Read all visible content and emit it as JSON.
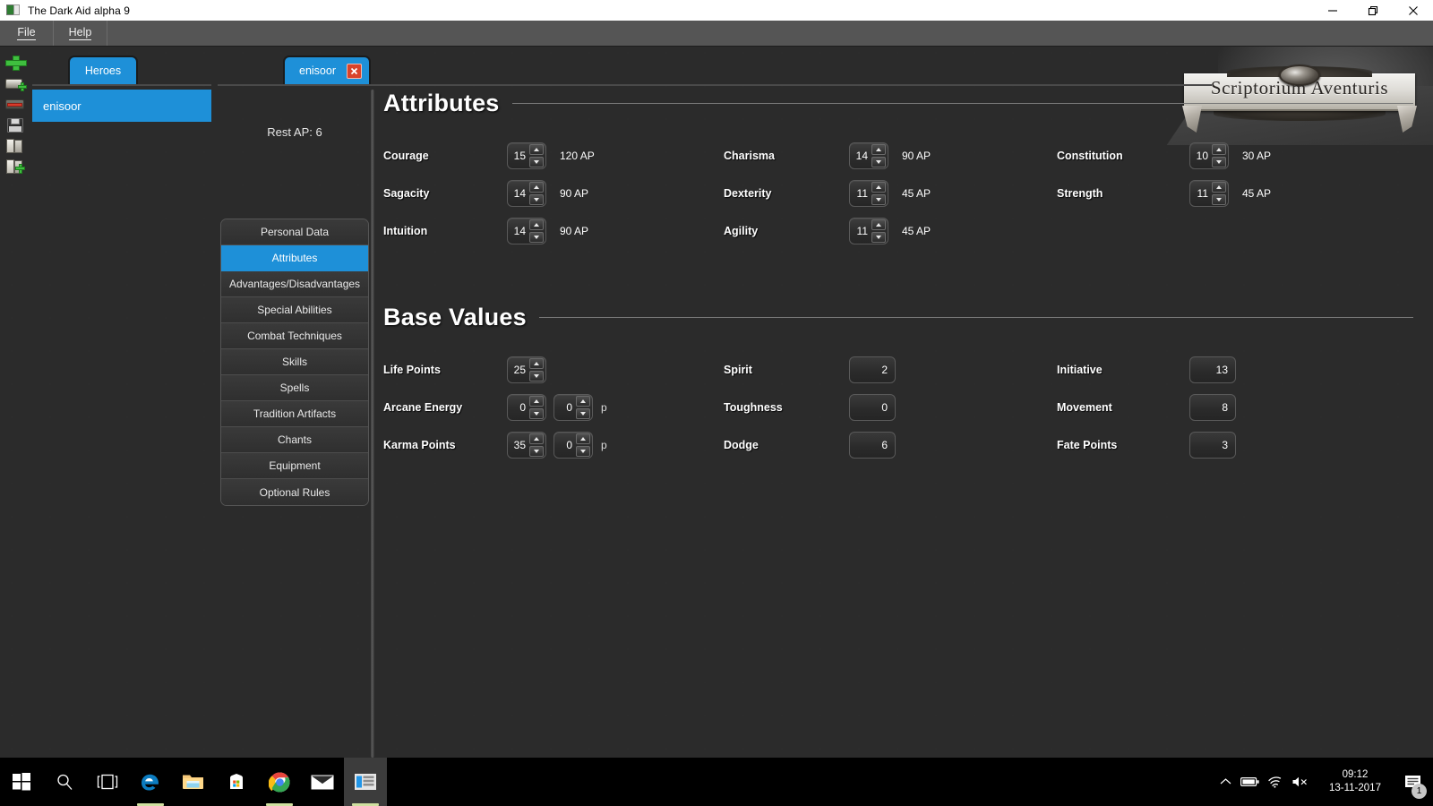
{
  "window": {
    "title": "The Dark Aid alpha 9",
    "icon": "app-icon",
    "controls": {
      "minimize": "minimize",
      "restore": "restore",
      "close": "close"
    }
  },
  "menubar": {
    "items": [
      {
        "label": "File"
      },
      {
        "label": "Help"
      }
    ]
  },
  "toolbar": {
    "icons": [
      {
        "name": "add-hero-icon",
        "title": "New"
      },
      {
        "name": "add-document-icon",
        "title": "New from template"
      },
      {
        "name": "delete-icon",
        "title": "Delete"
      },
      {
        "name": "save-icon",
        "title": "Save"
      },
      {
        "name": "open-book-icon",
        "title": "Open"
      },
      {
        "name": "open-add-icon",
        "title": "Open and add"
      }
    ]
  },
  "tabs": {
    "primary": {
      "label": "Heroes",
      "active": true
    },
    "secondary": {
      "label": "enisoor",
      "active": true,
      "close_label": "close-tab"
    }
  },
  "hero_list": {
    "items": [
      {
        "label": "enisoor",
        "selected": true
      }
    ]
  },
  "sidebar": {
    "rest_ap": "Rest AP: 6",
    "items": [
      {
        "label": "Personal Data",
        "active": false
      },
      {
        "label": "Attributes",
        "active": true
      },
      {
        "label": "Advantages/Disadvantages",
        "active": false
      },
      {
        "label": "Special Abilities",
        "active": false
      },
      {
        "label": "Combat Techniques",
        "active": false
      },
      {
        "label": "Skills",
        "active": false
      },
      {
        "label": "Spells",
        "active": false
      },
      {
        "label": "Tradition Artifacts",
        "active": false
      },
      {
        "label": "Chants",
        "active": false
      },
      {
        "label": "Equipment",
        "active": false
      },
      {
        "label": "Optional Rules",
        "active": false
      }
    ]
  },
  "attributes": {
    "title": "Attributes",
    "rows": [
      {
        "label": "Courage",
        "value": "15",
        "cost": "120 AP"
      },
      {
        "label": "Charisma",
        "value": "14",
        "cost": "90 AP"
      },
      {
        "label": "Constitution",
        "value": "10",
        "cost": "30 AP"
      },
      {
        "label": "Sagacity",
        "value": "14",
        "cost": "90 AP"
      },
      {
        "label": "Dexterity",
        "value": "11",
        "cost": "45 AP"
      },
      {
        "label": "Strength",
        "value": "11",
        "cost": "45 AP"
      },
      {
        "label": "Intuition",
        "value": "14",
        "cost": "90 AP"
      },
      {
        "label": "Agility",
        "value": "11",
        "cost": "45 AP"
      },
      {
        "label": "",
        "value": "",
        "cost": ""
      }
    ]
  },
  "base_values": {
    "title": "Base Values",
    "permanent_suffix": "p",
    "rows": [
      {
        "label": "Life Points",
        "value": "25",
        "perm": null,
        "type": "spinner"
      },
      {
        "label": "Spirit",
        "value": "2",
        "type": "readonly"
      },
      {
        "label": "Initiative",
        "value": "13",
        "type": "readonly"
      },
      {
        "label": "Arcane Energy",
        "value": "0",
        "perm": "0",
        "type": "spinner"
      },
      {
        "label": "Toughness",
        "value": "0",
        "type": "readonly"
      },
      {
        "label": "Movement",
        "value": "8",
        "type": "readonly"
      },
      {
        "label": "Karma Points",
        "value": "35",
        "perm": "0",
        "type": "spinner"
      },
      {
        "label": "Dodge",
        "value": "6",
        "type": "readonly"
      },
      {
        "label": "Fate Points",
        "value": "3",
        "type": "readonly"
      }
    ]
  },
  "logo": {
    "text": "Scriptorium Aventuris"
  },
  "taskbar": {
    "buttons": [
      {
        "name": "start-button"
      },
      {
        "name": "search-button"
      },
      {
        "name": "task-view-button"
      },
      {
        "name": "edge-button"
      },
      {
        "name": "file-explorer-button"
      },
      {
        "name": "microsoft-store-button"
      },
      {
        "name": "chrome-button"
      },
      {
        "name": "mail-button"
      },
      {
        "name": "dark-aid-button"
      }
    ],
    "tray": {
      "time": "09:12",
      "date": "13-11-2017",
      "notification_count": "1"
    }
  },
  "colors": {
    "accent": "#1e90d8",
    "background": "#2b2b2b",
    "panel": "#303030",
    "titlebar": "#ffffff",
    "menubar": "#555555",
    "close_red": "#d9432a",
    "icon_green": "#3fbf3f"
  }
}
